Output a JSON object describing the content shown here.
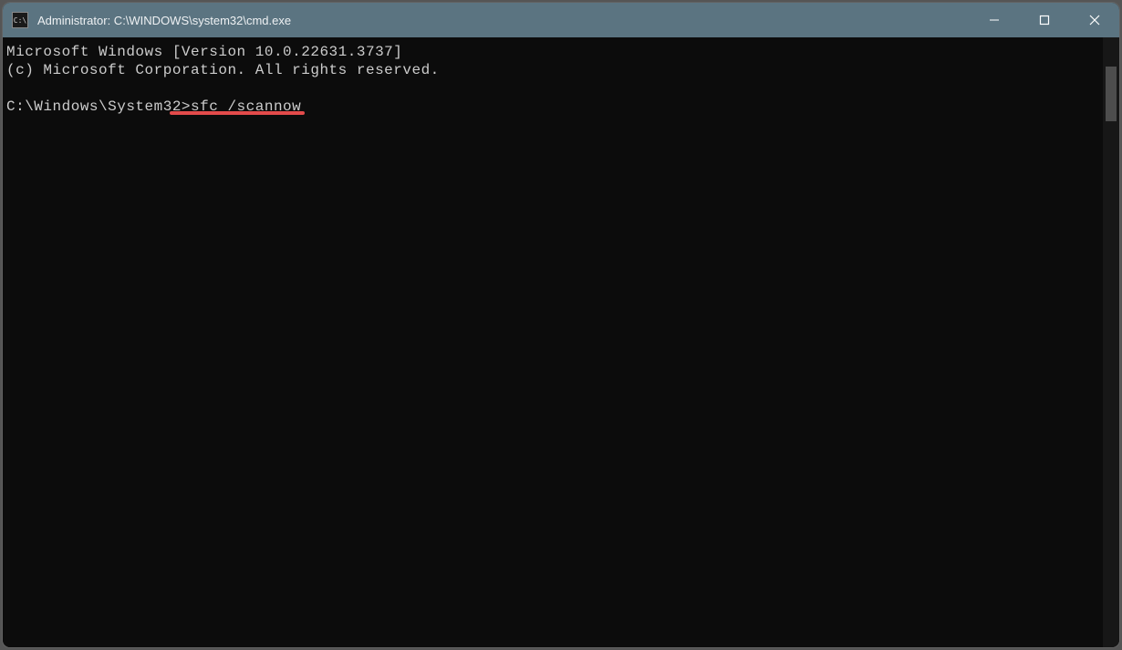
{
  "titlebar": {
    "title": "Administrator: C:\\WINDOWS\\system32\\cmd.exe",
    "app_icon_label": "cmd-icon"
  },
  "terminal": {
    "line1": "Microsoft Windows [Version 10.0.22631.3737]",
    "line2": "(c) Microsoft Corporation. All rights reserved.",
    "blank": "",
    "prompt": "C:\\Windows\\System32>",
    "command": "sfc /scannow"
  },
  "window_controls": {
    "minimize": "minimize",
    "maximize": "maximize",
    "close": "close"
  },
  "annotation": {
    "color": "#e34b4b"
  }
}
